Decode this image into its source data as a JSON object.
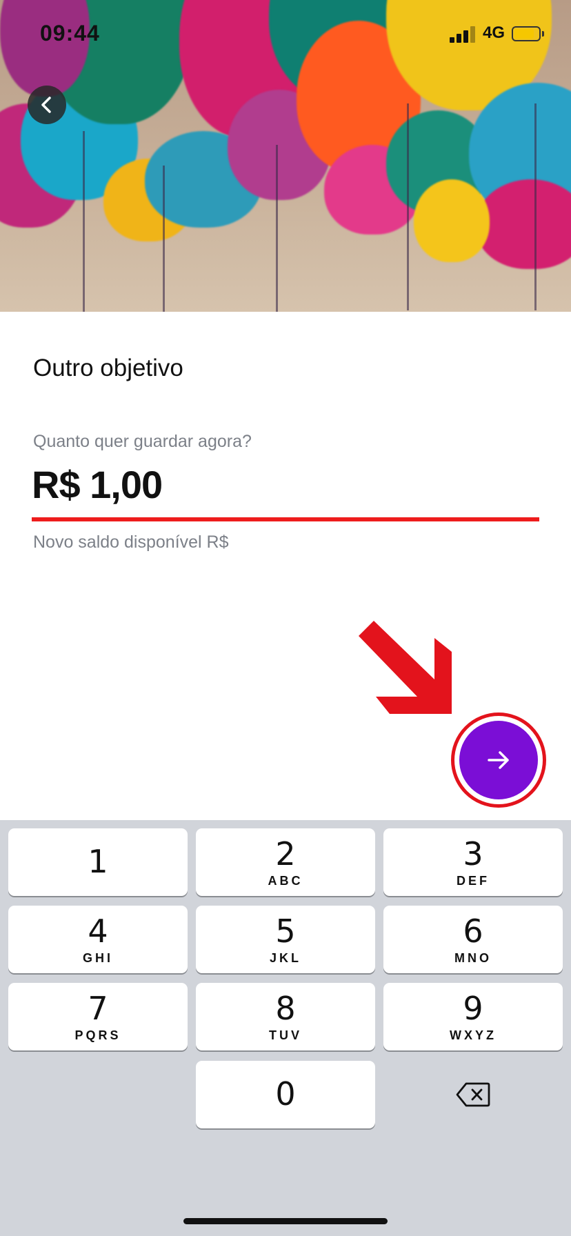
{
  "status_bar": {
    "time": "09:44",
    "network": "4G",
    "battery_color": "#f6c700"
  },
  "header": {
    "back_icon": "chevron-left-icon"
  },
  "content": {
    "title": "Outro objetivo",
    "prompt": "Quanto quer guardar agora?",
    "amount": "R$ 1,00",
    "balance_label": "Novo saldo disponível R$"
  },
  "next_button": {
    "icon": "arrow-right-icon",
    "color": "#7b0ed6"
  },
  "annotation": {
    "color": "#e3131c"
  },
  "keyboard": {
    "keys": [
      {
        "num": "1",
        "letters": ""
      },
      {
        "num": "2",
        "letters": "ABC"
      },
      {
        "num": "3",
        "letters": "DEF"
      },
      {
        "num": "4",
        "letters": "GHI"
      },
      {
        "num": "5",
        "letters": "JKL"
      },
      {
        "num": "6",
        "letters": "MNO"
      },
      {
        "num": "7",
        "letters": "PQRS"
      },
      {
        "num": "8",
        "letters": "TUV"
      },
      {
        "num": "9",
        "letters": "WXYZ"
      },
      {
        "num": "0",
        "letters": ""
      }
    ],
    "delete_icon": "backspace-icon"
  }
}
